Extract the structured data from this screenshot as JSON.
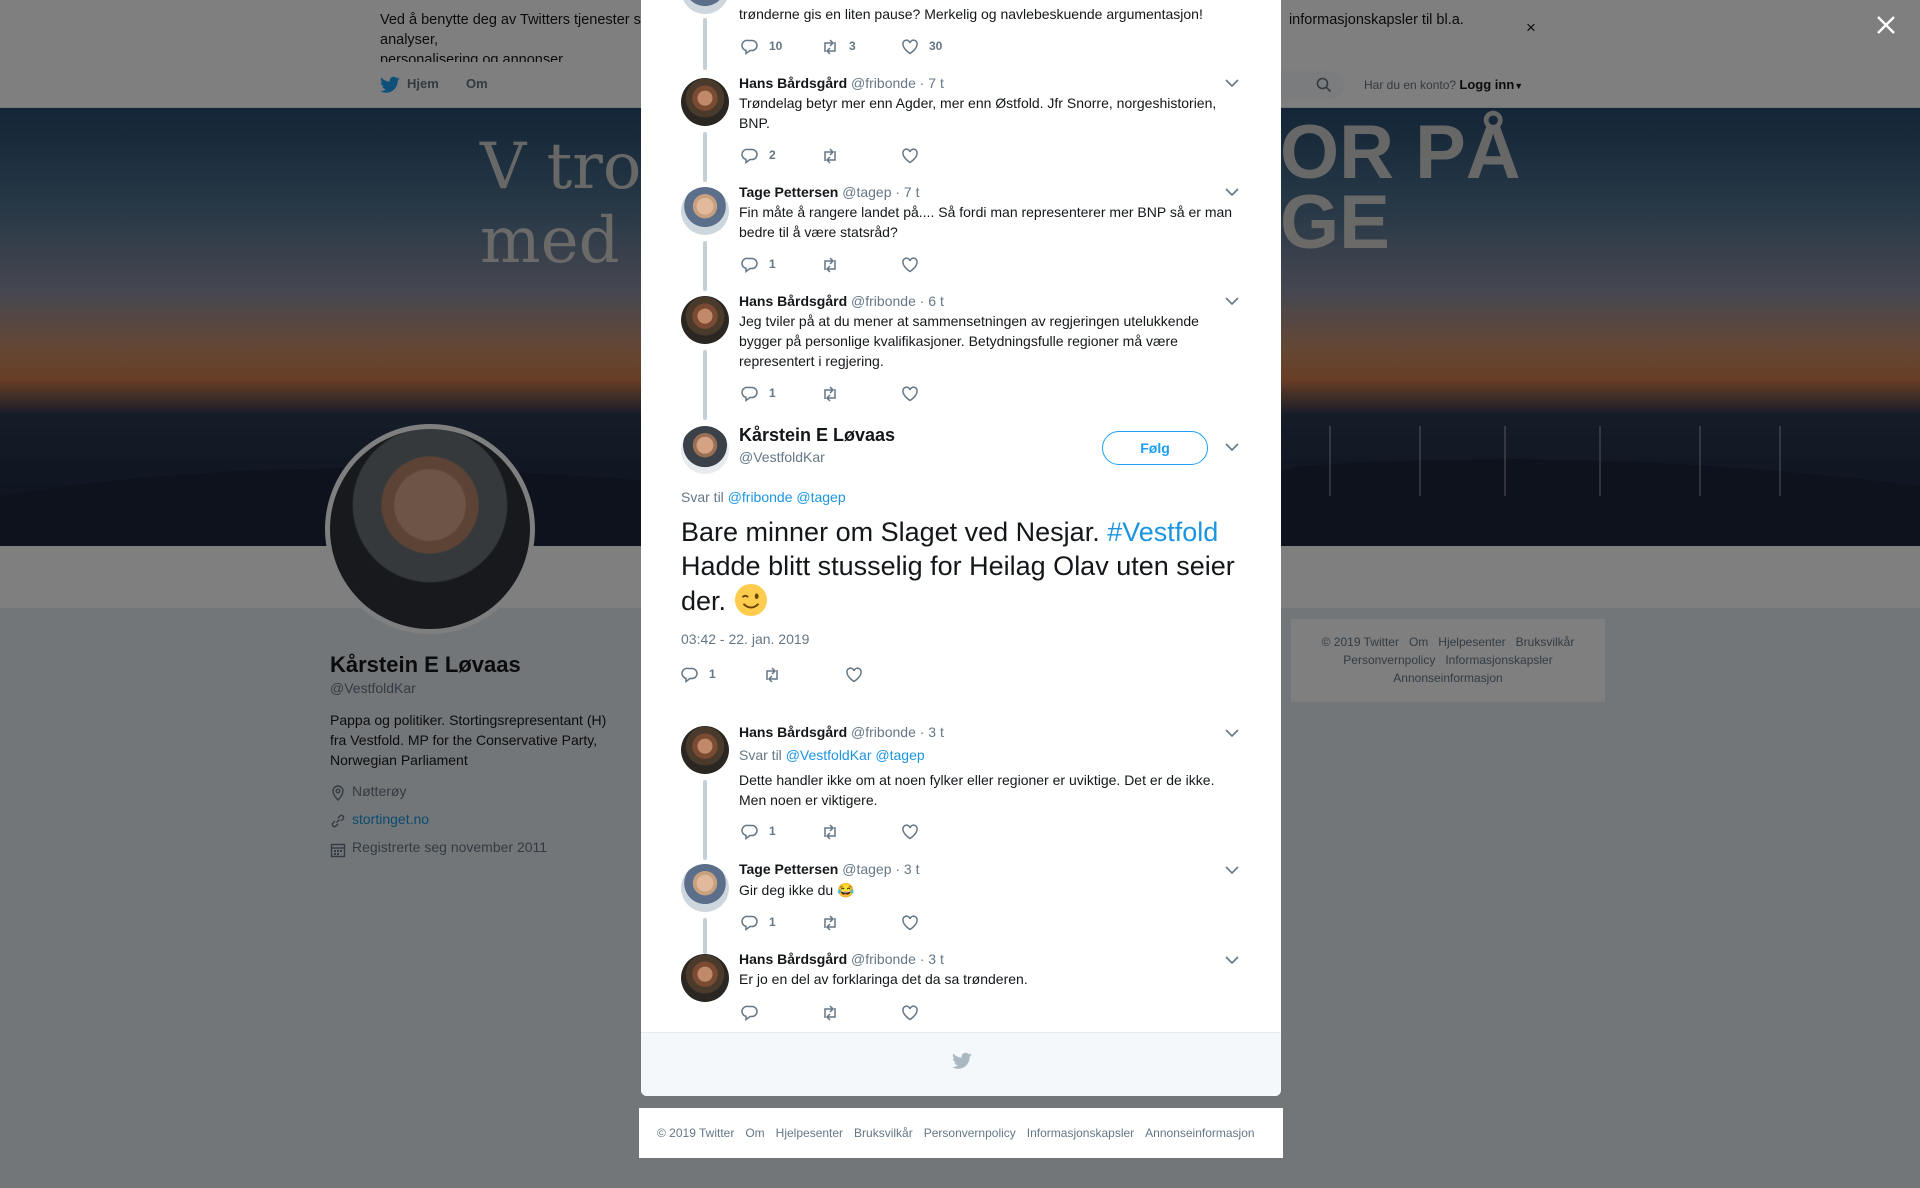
{
  "cookie": {
    "text_left": "Ved å benytte deg av Twitters tjenester sa",
    "text_right": "informasjonskapsler til bl.a. analyser,",
    "text_line2": "personalisering og annonser.",
    "close": "×"
  },
  "nav": {
    "home": "Hjem",
    "about": "Om",
    "account_prompt": "Har du en konto?",
    "login": "Logg inn"
  },
  "banner": {
    "text1_line1": "V tro",
    "text1_line2": "med r",
    "text2_line1": "OR PÅ",
    "text2_line2": "GE"
  },
  "profile": {
    "name": "Kårstein E Løvaas",
    "handle": "@VestfoldKar",
    "bio": "Pappa og politiker. Stortingsrepresentant (H) fra Vestfold. MP for the Conservative Party, Norwegian Parliament",
    "location": "Nøtterøy",
    "website": "stortinget.no",
    "joined": "Registrerte seg november 2011"
  },
  "side_footer": {
    "items": [
      "© 2019 Twitter",
      "Om",
      "Hjelpesenter",
      "Bruksvilkår",
      "Personvernpolicy",
      "Informasjonskapsler",
      "Annonseinformasjon"
    ]
  },
  "thread": {
    "top_fragment": {
      "text": "trønderne gis en liten pause? Merkelig og navlebeskuende argumentasjon!",
      "replies": "10",
      "retweets": "3",
      "likes": "30"
    },
    "tweets_before": [
      {
        "name": "Hans Bårdsgård",
        "handle": "@fribonde",
        "time": "· 7 t",
        "text": "Trøndelag betyr mer enn Agder, mer enn Østfold. Jfr Snorre, norgeshistorien, BNP.",
        "replies": "2"
      },
      {
        "name": "Tage Pettersen",
        "handle": "@tagep",
        "time": "· 7 t",
        "text": "Fin måte å rangere landet på.... Så fordi man representerer mer BNP så er man bedre til å være statsråd?",
        "replies": "1"
      },
      {
        "name": "Hans Bårdsgård",
        "handle": "@fribonde",
        "time": "· 6 t",
        "text": "Jeg tviler på at du mener at sammensetningen av regjeringen utelukkende bygger på personlige kvalifikasjoner. Betydningsfulle regioner må være representert i regjering.",
        "replies": "1"
      }
    ],
    "main": {
      "name": "Kårstein E Løvaas",
      "handle": "@VestfoldKar",
      "follow": "Følg",
      "reply_to": "Svar til",
      "reply_handles": "@fribonde @tagep",
      "text_before_hash": "Bare minner om Slaget ved Nesjar. ",
      "hashtag": "#Vestfold",
      "text_after": "Hadde blitt stusselig for Heilag Olav uten seier der.",
      "timestamp": "03:42 - 22. jan. 2019",
      "replies": "1"
    },
    "tweets_after": [
      {
        "name": "Hans Bårdsgård",
        "handle": "@fribonde",
        "time": "· 3 t",
        "reply_to": "Svar til",
        "reply_handles": "@VestfoldKar @tagep",
        "text": "Dette handler ikke om at noen fylker eller regioner er uviktige. Det er de ikke. Men noen er viktigere.",
        "replies": "1"
      },
      {
        "name": "Tage Pettersen",
        "handle": "@tagep",
        "time": "· 3 t",
        "text": "Gir deg ikke du 😂",
        "replies": "1"
      },
      {
        "name": "Hans Bårdsgård",
        "handle": "@fribonde",
        "time": "· 3 t",
        "text": "Er jo en del av forklaringa det da sa trønderen.",
        "replies": ""
      }
    ]
  },
  "bottom_footer": {
    "items": [
      "© 2019 Twitter",
      "Om",
      "Hjelpesenter",
      "Bruksvilkår",
      "Personvernpolicy",
      "Informasjonskapsler",
      "Annonseinformasjon"
    ]
  },
  "colors": {
    "accent": "#1da1f2",
    "link": "#1b95e0",
    "muted": "#657786",
    "thread_line": "#c4cfd6"
  }
}
